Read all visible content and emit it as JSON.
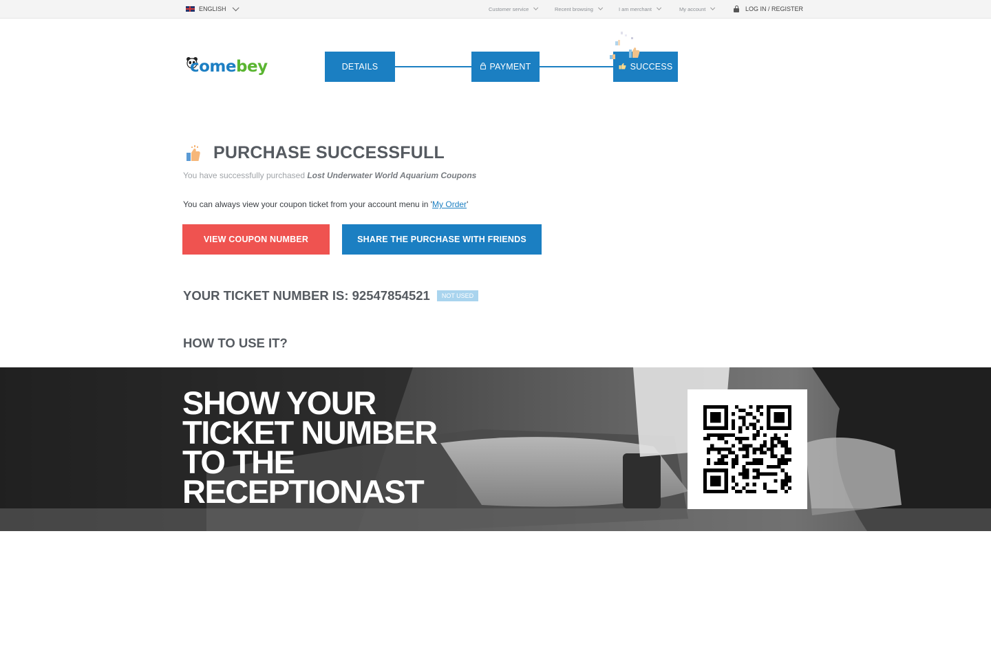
{
  "topbar": {
    "language": "ENGLISH",
    "nav": [
      "Customer service",
      "Recent browsing",
      "I am merchant",
      "My account"
    ],
    "login": "LOG IN / REGISTER"
  },
  "logo": {
    "part1": "come",
    "part2": "bey"
  },
  "steps": [
    "DETAILS",
    "PAYMENT",
    "SUCCESS"
  ],
  "main": {
    "title": "PURCHASE SUCCESSFULL",
    "subtitle_prefix": "You have successfully purchased ",
    "product": "Lost Underwater World Aquarium Coupons",
    "note_prefix": "You can always view your coupon ticket from  your account menu in '",
    "note_link": "My Order",
    "note_suffix": "'",
    "btn_view": "VIEW COUPON NUMBER",
    "btn_share": "SHARE THE PURCHASE WITH FRIENDS",
    "ticket_label": "YOUR TICKET NUMBER IS: 92547854521",
    "ticket_status": "NOT USED",
    "howto": "HOW TO USE IT?"
  },
  "banner": {
    "lines": [
      "SHOW YOUR",
      "TICKET NUMBER",
      "TO THE",
      "RECEPTIONAST"
    ]
  },
  "colors": {
    "primary": "#1b7fc2",
    "danger": "#ef5350",
    "badge": "#a9d4ee",
    "logo_blue": "#1d7fc3",
    "logo_green": "#5ab531"
  },
  "icons": [
    "flag-uk-icon",
    "chevron-down-icon",
    "lock-icon",
    "thumbs-up-icon",
    "qr-code"
  ]
}
